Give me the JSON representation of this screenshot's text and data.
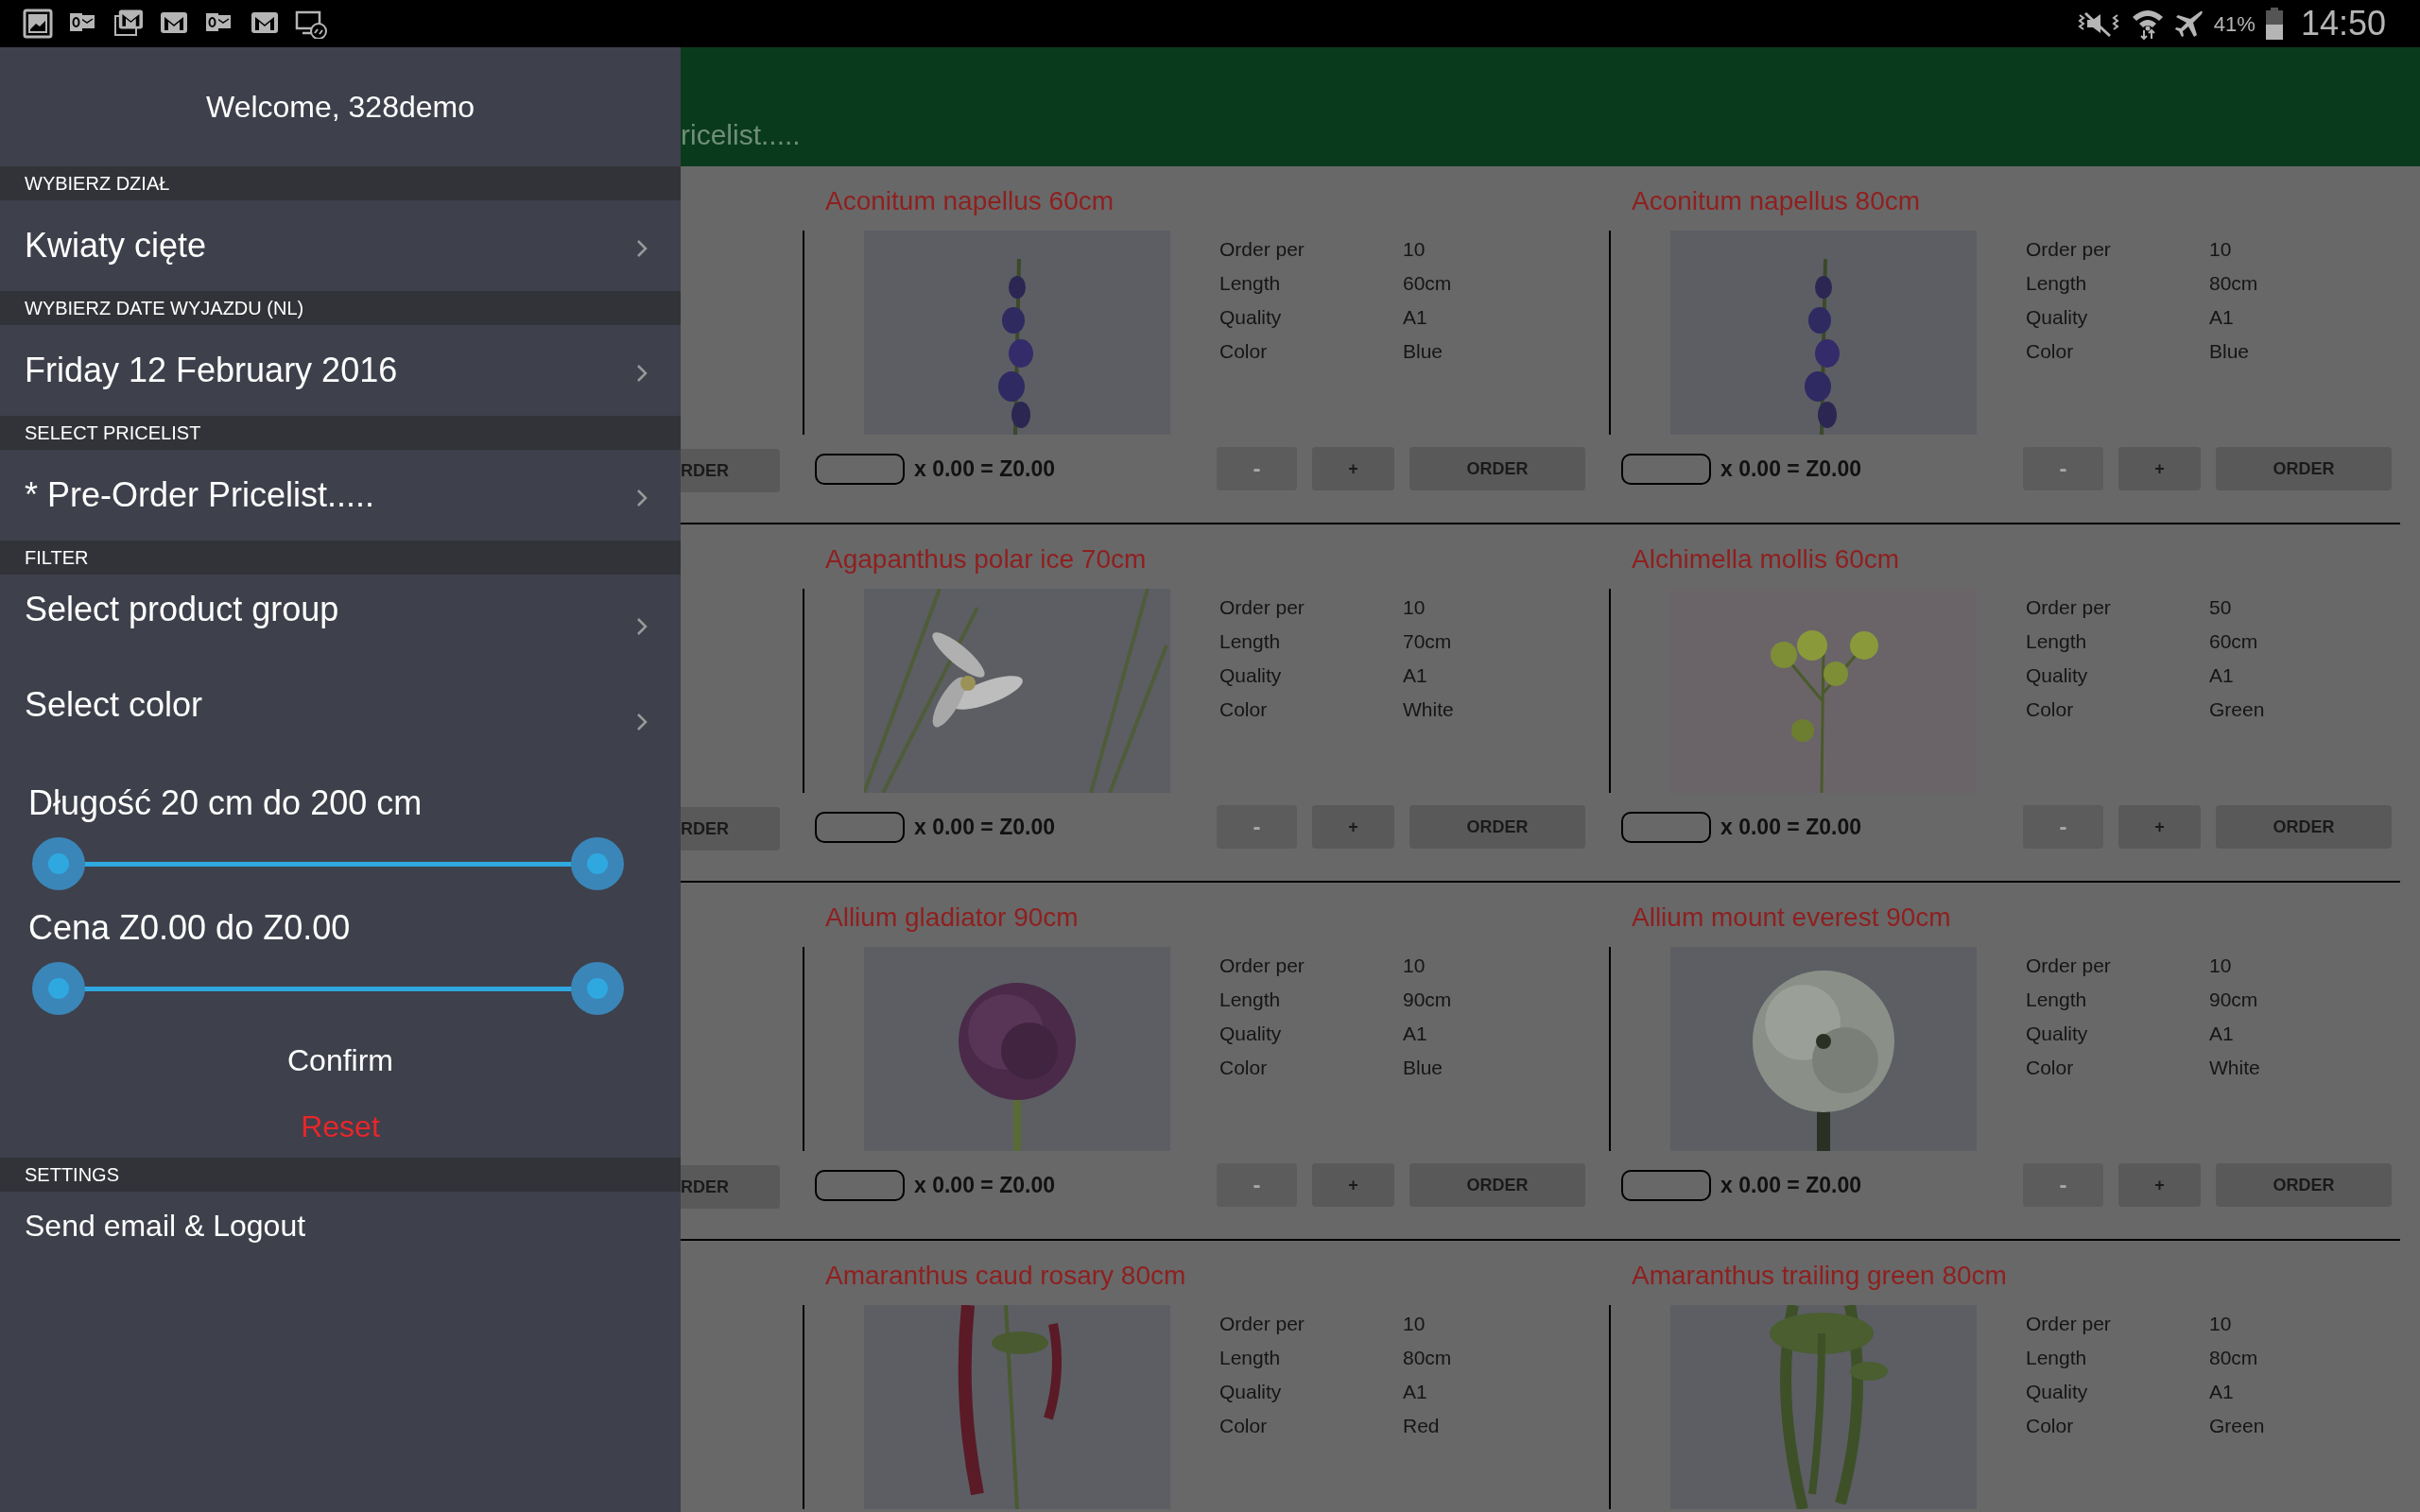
{
  "status_bar": {
    "battery": "41%",
    "time": "14:50"
  },
  "drawer": {
    "welcome": "Welcome, 328demo",
    "sections": [
      {
        "header": "WYBIERZ DZIAŁ",
        "items": [
          {
            "kind": "nav",
            "label": "Kwiaty cięte"
          }
        ]
      },
      {
        "header": "WYBIERZ DATE WYJAZDU (NL)",
        "items": [
          {
            "kind": "nav",
            "label": "Friday 12 February 2016"
          }
        ]
      },
      {
        "header": "SELECT PRICELIST",
        "items": [
          {
            "kind": "nav",
            "label": "* Pre-Order Pricelist....."
          }
        ]
      },
      {
        "header": "FILTER",
        "items": [
          {
            "kind": "filter",
            "label": "Select product group"
          },
          {
            "kind": "filter",
            "label": "Select color"
          },
          {
            "kind": "range",
            "label": "Długość 20 cm do 200 cm",
            "thumbs": [
              {
                "level": 0
              },
              {
                "level": 1
              }
            ]
          },
          {
            "kind": "range",
            "label": "Cena Z0.00 do Z0.00",
            "thumbs": [
              {
                "level": 0
              },
              {
                "level": 1
              }
            ]
          },
          {
            "kind": "confirm",
            "label": "Confirm"
          },
          {
            "kind": "reset",
            "label": "Reset"
          }
        ]
      },
      {
        "header": "SETTINGS",
        "items": [
          {
            "kind": "plain",
            "label": "Send email & Logout"
          }
        ]
      }
    ]
  },
  "main": {
    "header_title": "ricelist.....",
    "rows": [
      {
        "partial_button": "RDER",
        "products": [
          {
            "title": "Aconitum napellus 60cm",
            "specs": [
              {
                "label": "Order per",
                "value": "10"
              },
              {
                "label": "Length",
                "value": "60cm"
              },
              {
                "label": "Quality",
                "value": "A1"
              },
              {
                "label": "Color",
                "value": "Blue"
              }
            ],
            "total": "x 0.00 = Z0.00",
            "buttons": [
              {
                "label": "-",
                "disabled": true
              },
              {
                "label": "+",
                "disabled": false
              },
              {
                "label": "ORDER",
                "disabled": false
              }
            ]
          },
          {
            "title": "Aconitum napellus 80cm",
            "specs": [
              {
                "label": "Order per",
                "value": "10"
              },
              {
                "label": "Length",
                "value": "80cm"
              },
              {
                "label": "Quality",
                "value": "A1"
              },
              {
                "label": "Color",
                "value": "Blue"
              }
            ],
            "total": "x 0.00 = Z0.00",
            "buttons": [
              {
                "label": "-",
                "disabled": true
              },
              {
                "label": "+",
                "disabled": false
              },
              {
                "label": "ORDER",
                "disabled": false
              }
            ]
          }
        ]
      },
      {
        "partial_button": "RDER",
        "products": [
          {
            "title": "Agapanthus polar ice 70cm",
            "specs": [
              {
                "label": "Order per",
                "value": "10"
              },
              {
                "label": "Length",
                "value": "70cm"
              },
              {
                "label": "Quality",
                "value": "A1"
              },
              {
                "label": "Color",
                "value": "White"
              }
            ],
            "total": "x 0.00 = Z0.00",
            "buttons": [
              {
                "label": "-",
                "disabled": true
              },
              {
                "label": "+",
                "disabled": false
              },
              {
                "label": "ORDER",
                "disabled": false
              }
            ]
          },
          {
            "title": "Alchimella mollis 60cm",
            "specs": [
              {
                "label": "Order per",
                "value": "50"
              },
              {
                "label": "Length",
                "value": "60cm"
              },
              {
                "label": "Quality",
                "value": "A1"
              },
              {
                "label": "Color",
                "value": "Green"
              }
            ],
            "total": "x 0.00 = Z0.00",
            "buttons": [
              {
                "label": "-",
                "disabled": true
              },
              {
                "label": "+",
                "disabled": false
              },
              {
                "label": "ORDER",
                "disabled": false
              }
            ]
          }
        ]
      },
      {
        "partial_button": "RDER",
        "products": [
          {
            "title": "Allium gladiator 90cm",
            "specs": [
              {
                "label": "Order per",
                "value": "10"
              },
              {
                "label": "Length",
                "value": "90cm"
              },
              {
                "label": "Quality",
                "value": "A1"
              },
              {
                "label": "Color",
                "value": "Blue"
              }
            ],
            "total": "x 0.00 = Z0.00",
            "buttons": [
              {
                "label": "-",
                "disabled": true
              },
              {
                "label": "+",
                "disabled": false
              },
              {
                "label": "ORDER",
                "disabled": false
              }
            ]
          },
          {
            "title": "Allium mount everest 90cm",
            "specs": [
              {
                "label": "Order per",
                "value": "10"
              },
              {
                "label": "Length",
                "value": "90cm"
              },
              {
                "label": "Quality",
                "value": "A1"
              },
              {
                "label": "Color",
                "value": "White"
              }
            ],
            "total": "x 0.00 = Z0.00",
            "buttons": [
              {
                "label": "-",
                "disabled": true
              },
              {
                "label": "+",
                "disabled": false
              },
              {
                "label": "ORDER",
                "disabled": false
              }
            ]
          }
        ]
      },
      {
        "products": [
          {
            "title": "Amaranthus caud rosary 80cm",
            "specs": [
              {
                "label": "Order per",
                "value": "10"
              },
              {
                "label": "Length",
                "value": "80cm"
              },
              {
                "label": "Quality",
                "value": "A1"
              },
              {
                "label": "Color",
                "value": "Red"
              }
            ]
          },
          {
            "title": "Amaranthus trailing green 80cm",
            "specs": [
              {
                "label": "Order per",
                "value": "10"
              },
              {
                "label": "Length",
                "value": "80cm"
              },
              {
                "label": "Quality",
                "value": "A1"
              },
              {
                "label": "Color",
                "value": "Green"
              }
            ]
          }
        ]
      }
    ]
  }
}
